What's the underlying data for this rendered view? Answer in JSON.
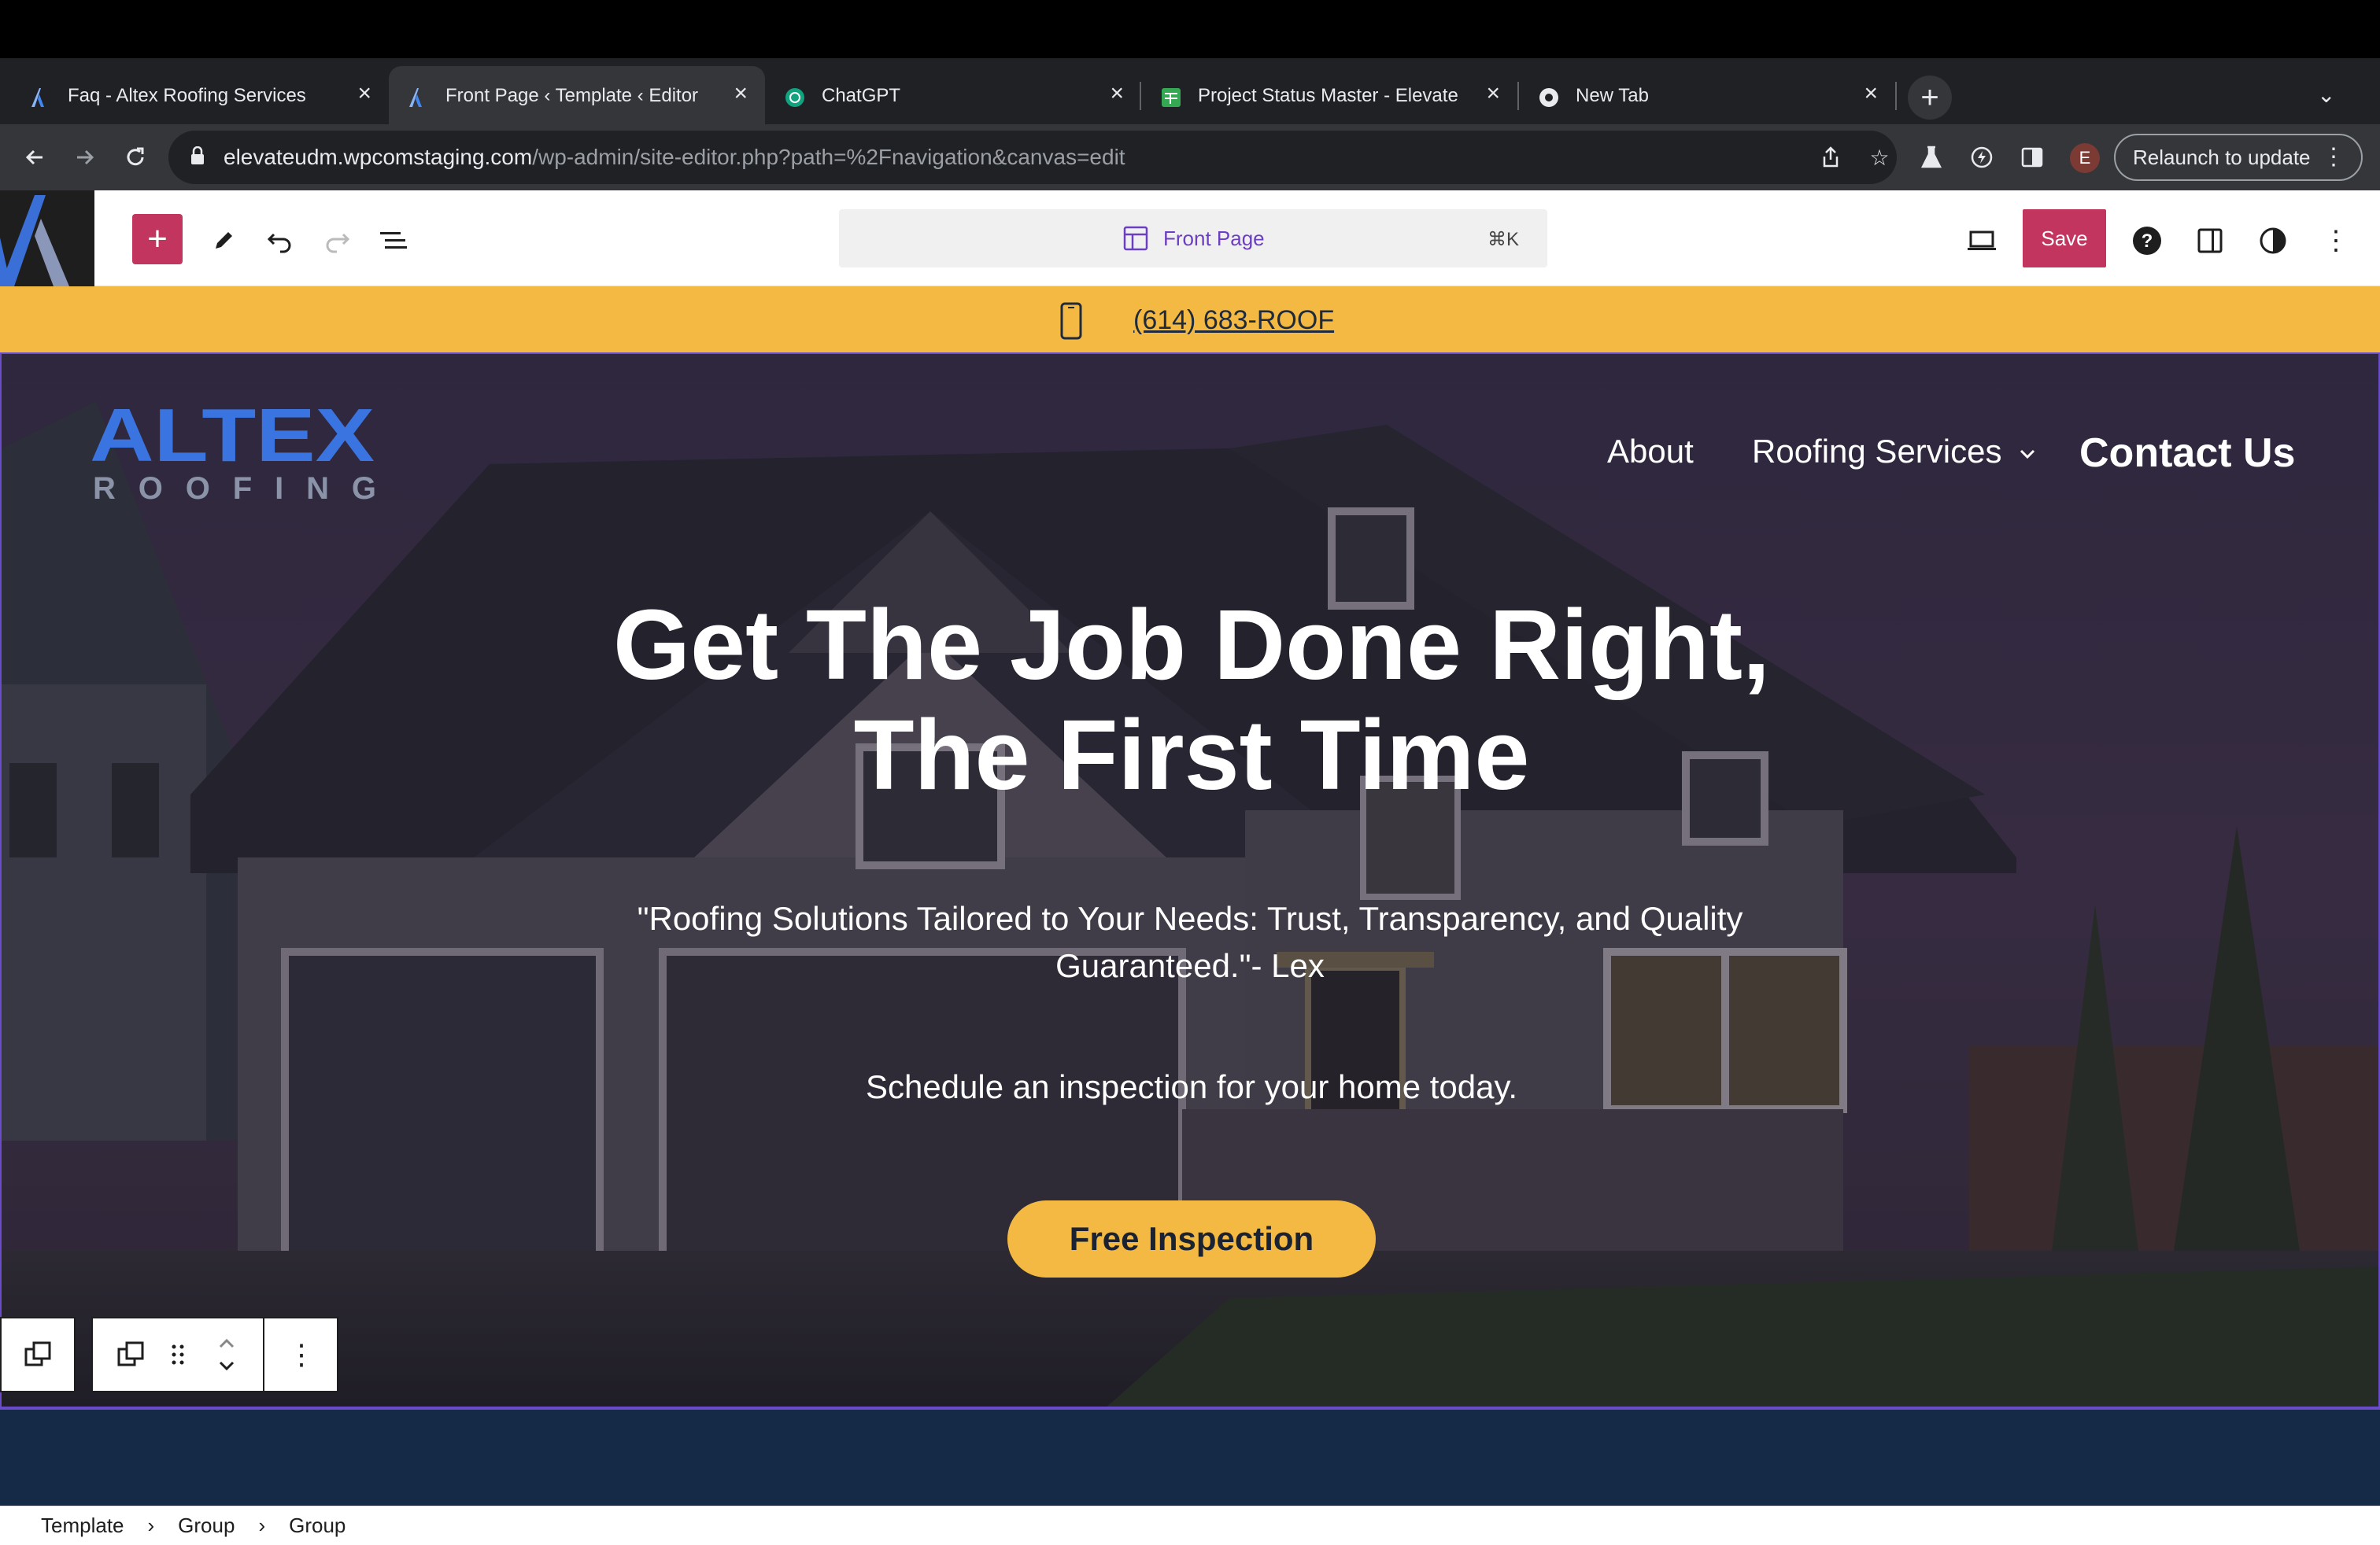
{
  "browser": {
    "tabs": [
      {
        "title": "Faq - Altex Roofing Services",
        "active": false,
        "favicon": "altex-logo-icon"
      },
      {
        "title": "Front Page ‹ Template ‹ Editor",
        "active": true,
        "favicon": "altex-logo-icon"
      },
      {
        "title": "ChatGPT",
        "active": false,
        "favicon": "chatgpt-icon"
      },
      {
        "title": "Project Status Master - Elevate",
        "active": false,
        "favicon": "sheets-icon"
      },
      {
        "title": "New Tab",
        "active": false,
        "favicon": "chrome-icon"
      }
    ],
    "new_tab_label": "+",
    "url_host": "elevateudm.wpcomstaging.com",
    "url_path": "/wp-admin/site-editor.php?path=%2Fnavigation&canvas=edit",
    "avatar_initial": "E",
    "relaunch_label": "Relaunch to update"
  },
  "editor": {
    "add_label": "+",
    "command_label": "Front Page",
    "command_shortcut": "⌘K",
    "save_label": "Save",
    "accent_color": "#c2355f"
  },
  "site": {
    "phone": "(614) 683-ROOF",
    "logo_word": "ALTEX",
    "logo_sub": "ROOFING",
    "nav": {
      "about": "About",
      "services": "Roofing Services",
      "contact": "Contact Us"
    },
    "headline_1": "Get The Job Done Right,",
    "headline_2": "The First Time",
    "quote": "\"Roofing Solutions Tailored to Your Needs: Trust, Transparency, and Quality Guaranteed.\"- Lex",
    "subtext": "Schedule an inspection for your home today.",
    "cta_label": "Free Inspection",
    "brand_yellow": "#f3b942",
    "brand_navy": "#142a47"
  },
  "breadcrumb": [
    "Template",
    "Group",
    "Group"
  ]
}
